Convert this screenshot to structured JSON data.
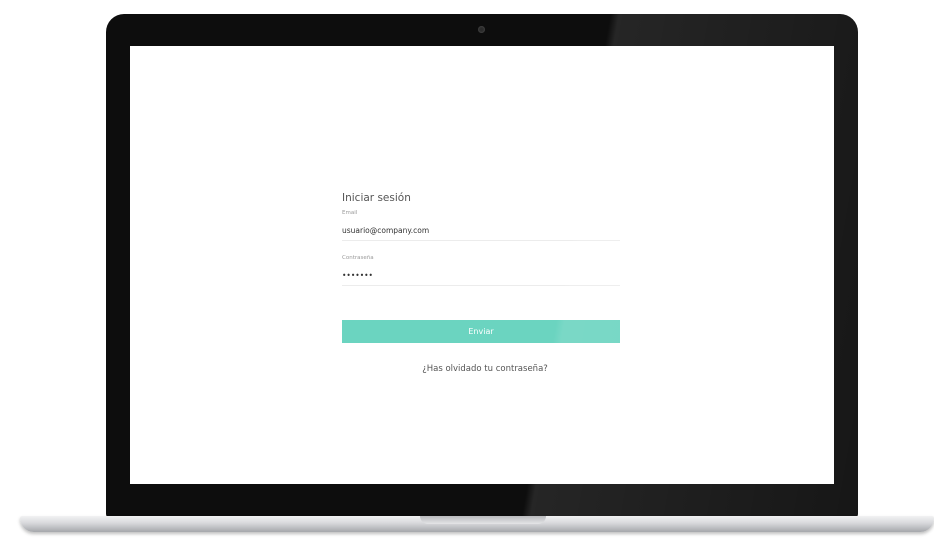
{
  "login": {
    "title": "Iniciar sesión",
    "email_label": "Email",
    "email_value": "usuario@company.com",
    "password_label": "Contraseña",
    "password_value": "•••••••",
    "submit_label": "Enviar",
    "forgot_link": "¿Has olvidado tu contraseña?"
  },
  "colors": {
    "accent": "#6bd4c0",
    "bezel": "#0d0d0d",
    "screen_bg": "#ffffff"
  }
}
